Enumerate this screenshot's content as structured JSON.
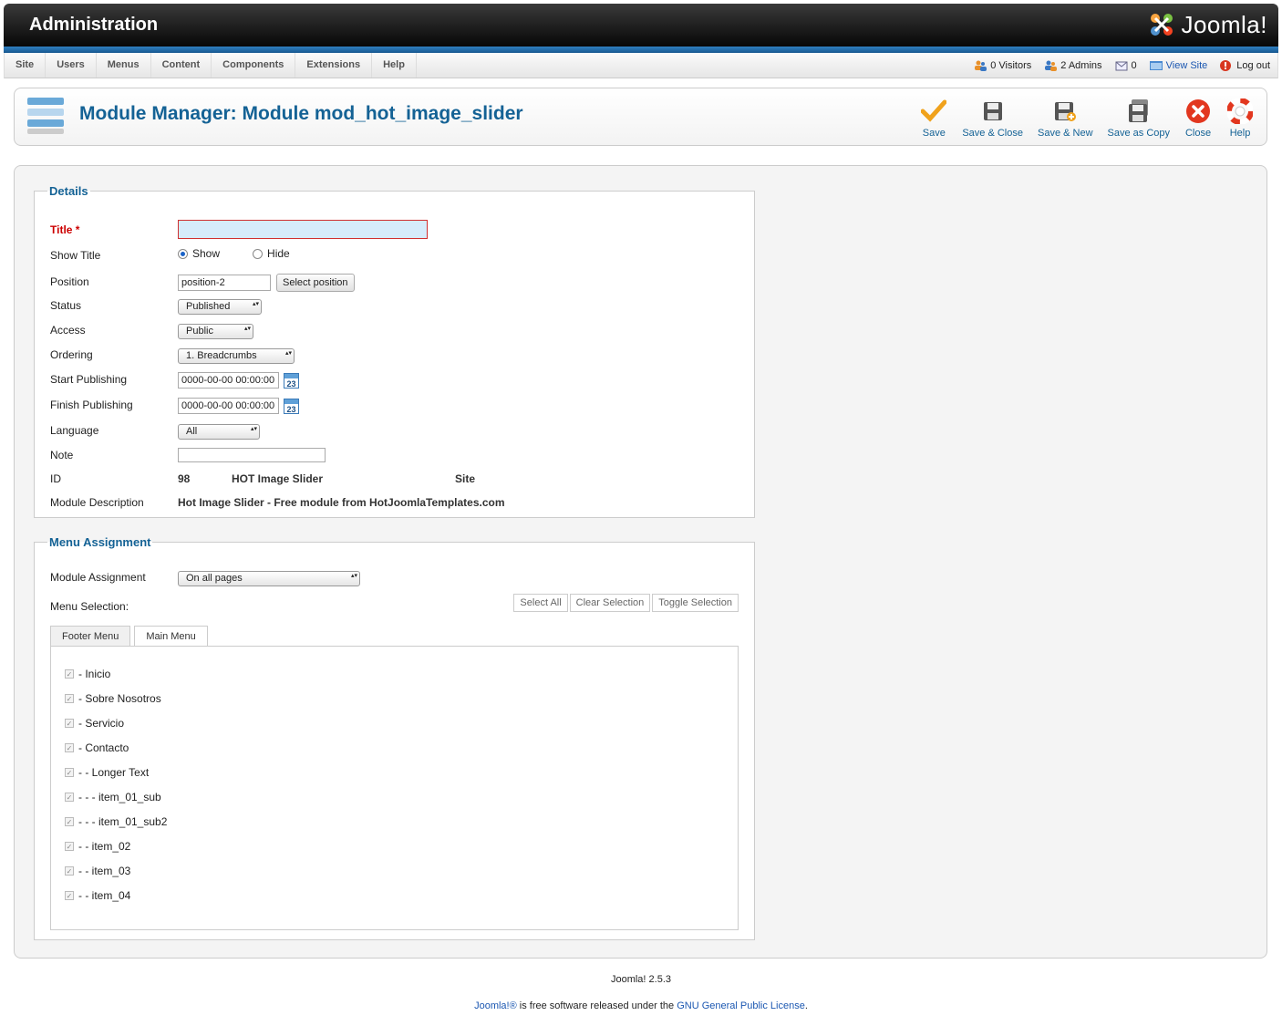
{
  "header": {
    "title": "Administration",
    "logo_text": "Joomla!"
  },
  "menu": [
    "Site",
    "Users",
    "Menus",
    "Content",
    "Components",
    "Extensions",
    "Help"
  ],
  "status": {
    "visitors": "0 Visitors",
    "admins": "2 Admins",
    "messages": "0",
    "view_site": "View Site",
    "logout": "Log out"
  },
  "page": {
    "title": "Module Manager: Module mod_hot_image_slider"
  },
  "toolbar": {
    "save": "Save",
    "save_close": "Save & Close",
    "save_new": "Save & New",
    "save_copy": "Save as Copy",
    "close": "Close",
    "help": "Help"
  },
  "details": {
    "legend": "Details",
    "title_label": "Title",
    "required_mark": "*",
    "title_value": "",
    "show_title_label": "Show Title",
    "show_label": "Show",
    "hide_label": "Hide",
    "position_label": "Position",
    "position_value": "position-2",
    "select_position": "Select position",
    "status_label": "Status",
    "status_value": "Published",
    "access_label": "Access",
    "access_value": "Public",
    "ordering_label": "Ordering",
    "ordering_value": "1. Breadcrumbs",
    "start_label": "Start Publishing",
    "start_value": "0000-00-00 00:00:00",
    "finish_label": "Finish Publishing",
    "finish_value": "0000-00-00 00:00:00",
    "calendar_day": "23",
    "language_label": "Language",
    "language_value": "All",
    "note_label": "Note",
    "note_value": "",
    "id_label": "ID",
    "id_value": "98",
    "module_name": "HOT Image Slider",
    "client": "Site",
    "desc_label": "Module Description",
    "desc_value": "Hot Image Slider - Free module from HotJoomlaTemplates.com"
  },
  "assignment": {
    "legend": "Menu Assignment",
    "module_assignment_label": "Module Assignment",
    "module_assignment_value": "On all pages",
    "menu_selection_label": "Menu Selection:",
    "select_all": "Select All",
    "clear_selection": "Clear Selection",
    "toggle_selection": "Toggle Selection",
    "tabs": [
      "Footer Menu",
      "Main Menu"
    ],
    "items": [
      "- Inicio",
      "- Sobre Nosotros",
      "- Servicio",
      "- Contacto",
      "- - Longer Text",
      "- - - item_01_sub",
      "- - - item_01_sub2",
      "- - item_02",
      "- - item_03",
      "- - item_04"
    ]
  },
  "footer": {
    "version": "Joomla! 2.5.3",
    "joomla_link": "Joomla!®",
    "license_pre": " is free software released under the ",
    "license_link": "GNU General Public License",
    "license_post": "."
  },
  "colors": {
    "accent": "#146295",
    "link": "#1b57b1",
    "header_blue": "#1f6fb0"
  }
}
